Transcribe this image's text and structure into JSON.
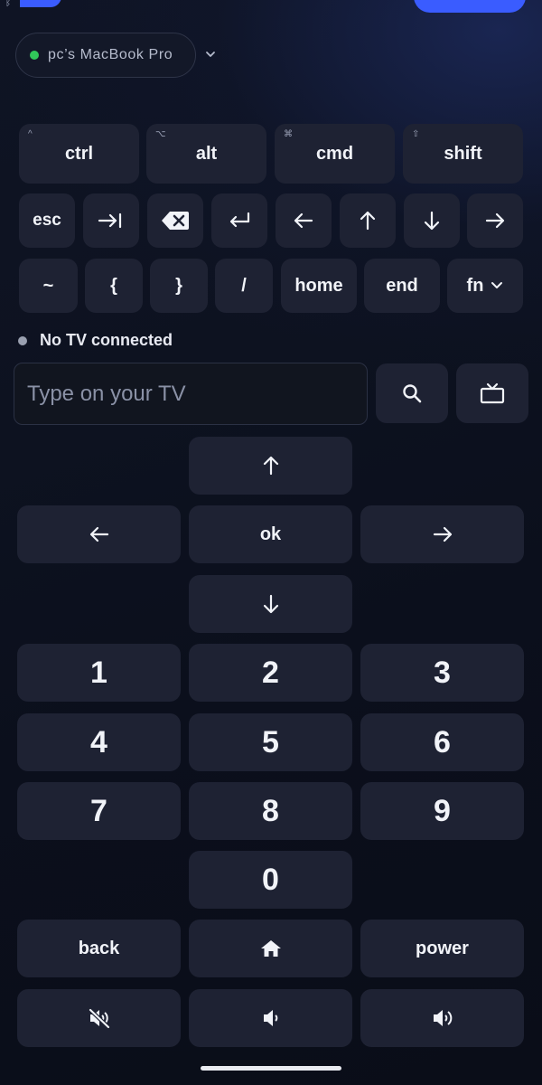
{
  "device": {
    "name": "pc’s MacBook Pro",
    "status_color": "#31c85a"
  },
  "modifiers": [
    {
      "symbol": "^",
      "label": "ctrl"
    },
    {
      "symbol": "⌥",
      "label": "alt"
    },
    {
      "symbol": "⌘",
      "label": "cmd"
    },
    {
      "symbol": "⇧",
      "label": "shift"
    }
  ],
  "nav_keys": {
    "esc": "esc",
    "tab_icon": "tab-icon",
    "backspace_icon": "backspace-icon",
    "enter_icon": "enter-icon",
    "left_icon": "arrow-left-icon",
    "up_icon": "arrow-up-icon",
    "down_icon": "arrow-down-icon",
    "right_icon": "arrow-right-icon"
  },
  "symbol_keys": {
    "tilde": "~",
    "lbrace": "{",
    "rbrace": "}",
    "slash": "/",
    "home": "home",
    "end": "end",
    "fn": "fn"
  },
  "tv": {
    "status": "No TV connected",
    "input_placeholder": "Type on your TV",
    "input_value": ""
  },
  "dpad": {
    "ok": "ok"
  },
  "numpad": [
    "1",
    "2",
    "3",
    "4",
    "5",
    "6",
    "7",
    "8",
    "9",
    "0"
  ],
  "bottom_row": {
    "back": "back",
    "power": "power"
  },
  "colors": {
    "accent": "#3a5cff",
    "key_bg": "#1e2233",
    "background": "#0d1220"
  }
}
